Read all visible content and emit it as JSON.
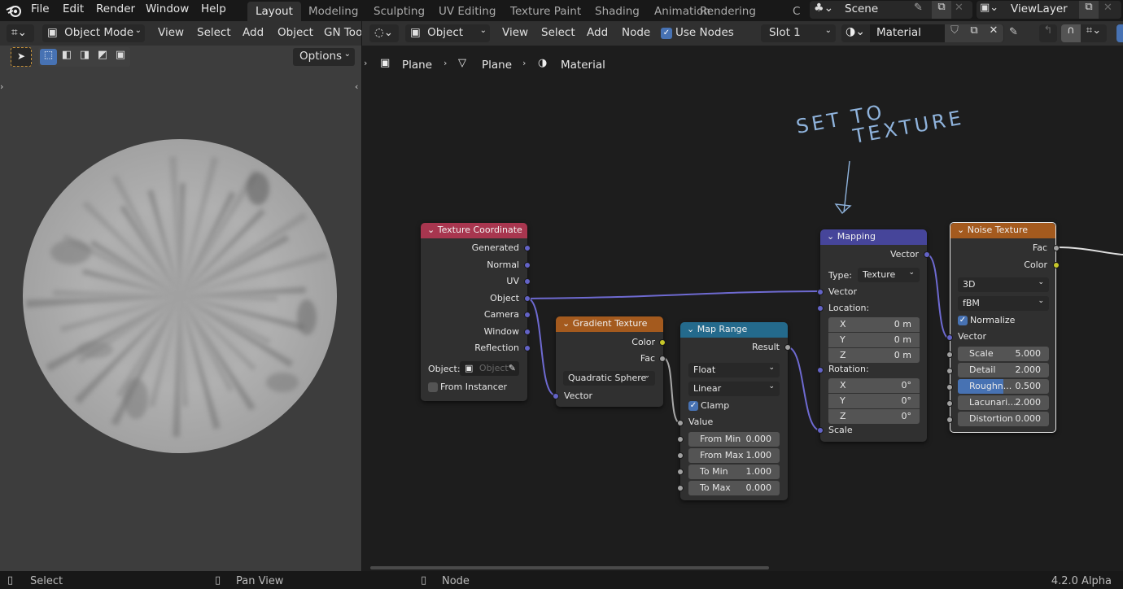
{
  "menubar": {
    "items": [
      "File",
      "Edit",
      "Render",
      "Window",
      "Help"
    ],
    "workspaces": [
      "Layout",
      "Modeling",
      "Sculpting",
      "UV Editing",
      "Texture Paint",
      "Shading",
      "Animation",
      "Rendering",
      "C"
    ],
    "active_workspace": "Layout",
    "scene": "Scene",
    "view_layer": "ViewLayer"
  },
  "viewport_header": {
    "mode": "Object Mode",
    "menus": [
      "View",
      "Select",
      "Add",
      "Object",
      "GN Too"
    ],
    "options_label": "Options"
  },
  "node_header": {
    "shader_type": "Object",
    "menus": [
      "View",
      "Select",
      "Add",
      "Node"
    ],
    "use_nodes_label": "Use Nodes",
    "use_nodes_checked": true,
    "slot": "Slot 1",
    "material": "Material"
  },
  "breadcrumb": [
    "Plane",
    "Plane",
    "Material"
  ],
  "annotation": {
    "line1": "SET TO",
    "line2": "TEXTURE",
    "color": "#8fb3dc"
  },
  "nodes": {
    "texture_coordinate": {
      "title": "Texture Coordinate",
      "color": "#a8364f",
      "outputs": [
        "Generated",
        "Normal",
        "UV",
        "Object",
        "Camera",
        "Window",
        "Reflection"
      ],
      "object_label": "Object:",
      "object_placeholder": "Object",
      "from_instancer_label": "From Instancer",
      "from_instancer_checked": false
    },
    "gradient_texture": {
      "title": "Gradient Texture",
      "color": "#a45a1e",
      "outputs": [
        "Color",
        "Fac"
      ],
      "type": "Quadratic Sphere",
      "inputs": [
        "Vector"
      ]
    },
    "map_range": {
      "title": "Map Range",
      "color": "#246a8c",
      "outputs": [
        "Result"
      ],
      "data_type": "Float",
      "interpolation": "Linear",
      "clamp_label": "Clamp",
      "clamp_checked": true,
      "value_label": "Value",
      "fields": [
        {
          "label": "From Min",
          "value": "0.000"
        },
        {
          "label": "From Max",
          "value": "1.000"
        },
        {
          "label": "To Min",
          "value": "1.000"
        },
        {
          "label": "To Max",
          "value": "0.000"
        }
      ]
    },
    "mapping": {
      "title": "Mapping",
      "color": "#46459a",
      "outputs": [
        "Vector"
      ],
      "type_label": "Type:",
      "type_value": "Texture",
      "vector_label": "Vector",
      "location_label": "Location:",
      "location": [
        {
          "axis": "X",
          "value": "0 m"
        },
        {
          "axis": "Y",
          "value": "0 m"
        },
        {
          "axis": "Z",
          "value": "0 m"
        }
      ],
      "rotation_label": "Rotation:",
      "rotation": [
        {
          "axis": "X",
          "value": "0°"
        },
        {
          "axis": "Y",
          "value": "0°"
        },
        {
          "axis": "Z",
          "value": "0°"
        }
      ],
      "scale_label": "Scale"
    },
    "noise_texture": {
      "title": "Noise Texture",
      "color": "#a45a1e",
      "outputs": [
        "Fac",
        "Color"
      ],
      "dimensions": "3D",
      "noise_type": "fBM",
      "normalize_label": "Normalize",
      "normalize_checked": true,
      "vector_label": "Vector",
      "fields": [
        {
          "label": "Scale",
          "value": "5.000"
        },
        {
          "label": "Detail",
          "value": "2.000"
        },
        {
          "label": "Roughn...",
          "value": "0.500",
          "fill": 0.5
        },
        {
          "label": "Lacunari...",
          "value": "2.000"
        },
        {
          "label": "Distortion",
          "value": "0.000"
        }
      ]
    }
  },
  "statusbar": {
    "left": "Select",
    "middle": "Pan View",
    "right": "Node",
    "version": "4.2.0 Alpha"
  }
}
